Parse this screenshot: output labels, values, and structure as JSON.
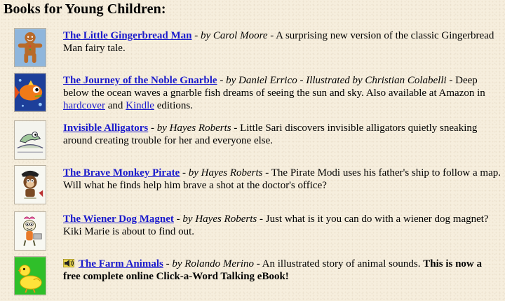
{
  "heading": "Books for Young Children:",
  "books": [
    {
      "title": "The Little Gingerbread Man",
      "byline": " - by Carol Moore",
      "desc": " - A surprising new version of the classic Gingerbread Man fairy tale."
    },
    {
      "title": "The Journey of the Noble Gnarble",
      "byline": " - by Daniel Errico - Illustrated by Christian Colabelli",
      "desc_before": " - Deep below the ocean waves a gnarble fish dreams of seeing the sun and sky. Also available at Amazon in ",
      "link1": "hardcover",
      "desc_mid": " and ",
      "link2": "Kindle",
      "desc_after": " editions."
    },
    {
      "title": "Invisible Alligators",
      "byline": " - by Hayes Roberts",
      "desc": " - Little Sari discovers invisible alligators quietly sneaking around creating trouble for her and everyone else."
    },
    {
      "title": "The Brave Monkey Pirate",
      "byline": " - by Hayes Roberts",
      "desc": " - The Pirate Modi uses his father's ship to follow a map. Will what he finds help him brave a shot at the doctor's office?"
    },
    {
      "title": "The Wiener Dog Magnet",
      "byline": " - by Hayes Roberts",
      "desc": " - Just what is it you can do with a wiener dog magnet? Kiki Marie is about to find out."
    },
    {
      "title": "The Farm Animals",
      "byline": " - by Rolando Merino",
      "desc": " - An illustrated story of animal sounds. ",
      "desc_bold": "This is now a free complete online Click-a-Word Talking eBook!"
    }
  ],
  "colors": {
    "link": "#1a1acc",
    "background": "#f6eedd"
  },
  "icons": [
    "gingerbread-man-icon",
    "gnarble-fish-icon",
    "alligator-icon",
    "monkey-pirate-icon",
    "wiener-dog-icon",
    "duck-icon",
    "speaker-icon"
  ]
}
